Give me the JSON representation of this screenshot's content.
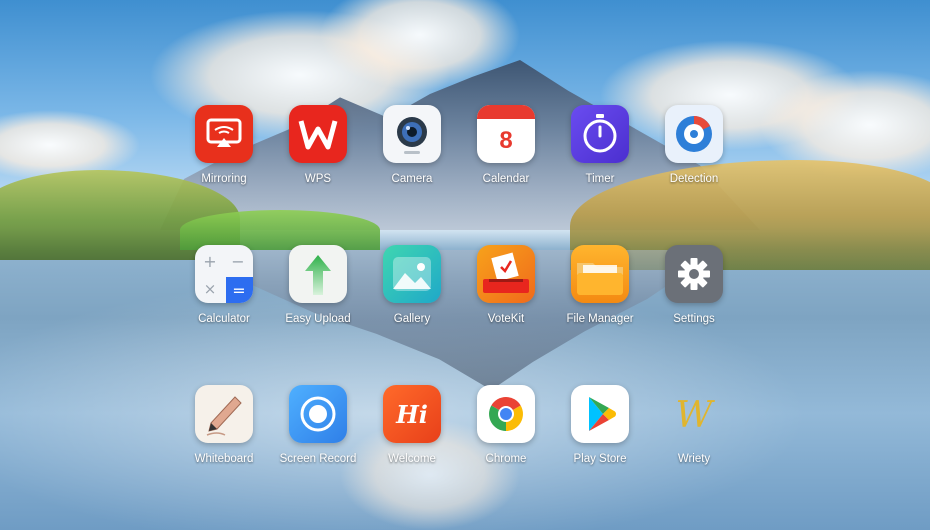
{
  "screen": "Android launcher home screen",
  "apps": [
    {
      "id": "mirroring",
      "label": "Mirroring",
      "icon": "mirroring-icon",
      "color": "#e8301c"
    },
    {
      "id": "wps",
      "label": "WPS",
      "icon": "wps-icon",
      "color": "#e8261e"
    },
    {
      "id": "camera",
      "label": "Camera",
      "icon": "camera-icon",
      "color": "#f4f6f9"
    },
    {
      "id": "calendar",
      "label": "Calendar",
      "icon": "calendar-icon",
      "color": "#e83a2f",
      "day": "8"
    },
    {
      "id": "timer",
      "label": "Timer",
      "icon": "timer-icon",
      "color": "#5a3de0"
    },
    {
      "id": "detection",
      "label": "Detection",
      "icon": "detection-icon",
      "color": "#2e7fd8"
    },
    {
      "id": "calculator",
      "label": "Calculator",
      "icon": "calculator-icon",
      "color": "#2d6df0"
    },
    {
      "id": "easy-upload",
      "label": "Easy Upload",
      "icon": "easy-upload-icon",
      "color": "#2fb14a"
    },
    {
      "id": "gallery",
      "label": "Gallery",
      "icon": "gallery-icon",
      "color": "#25c2a8"
    },
    {
      "id": "votekit",
      "label": "VoteKit",
      "icon": "votekit-icon",
      "color": "#e8261e"
    },
    {
      "id": "file-manager",
      "label": "File Manager",
      "icon": "folder-icon",
      "color": "#f7a21b"
    },
    {
      "id": "settings",
      "label": "Settings",
      "icon": "gear-icon",
      "color": "#6b7078"
    },
    {
      "id": "whiteboard",
      "label": "Whiteboard",
      "icon": "whiteboard-pen-icon",
      "color": "#f3ede6"
    },
    {
      "id": "screen-record",
      "label": "Screen Record",
      "icon": "screen-record-icon",
      "color": "#2f8ff0"
    },
    {
      "id": "welcome",
      "label": "Welcome",
      "icon": "welcome-hi-icon",
      "color": "#f04d15",
      "text": "Hi"
    },
    {
      "id": "chrome",
      "label": "Chrome",
      "icon": "chrome-icon",
      "color": "#ffffff"
    },
    {
      "id": "play-store",
      "label": "Play Store",
      "icon": "play-store-icon",
      "color": "#ffffff"
    },
    {
      "id": "wriety",
      "label": "Wriety",
      "icon": "wriety-logo-icon",
      "color": "#e0b52e",
      "text": "W"
    }
  ]
}
